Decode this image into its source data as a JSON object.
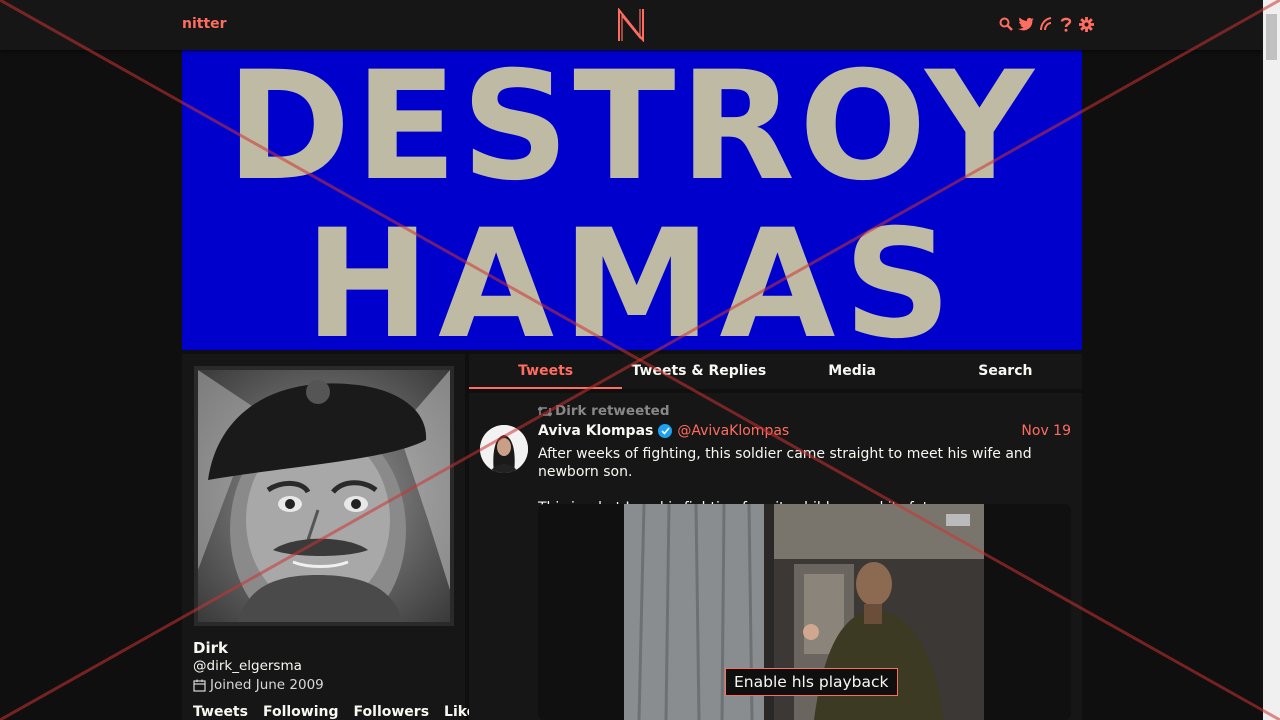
{
  "navbar": {
    "brand": "nitter",
    "icons": [
      "search-icon",
      "twitter-icon",
      "rss-icon",
      "help-icon",
      "settings-icon"
    ]
  },
  "banner": {
    "line1": "DESTROY",
    "line2": "HAMAS",
    "colors": {
      "background": "#0000cc",
      "text": "#bfbaa3"
    }
  },
  "profile": {
    "name": "Dirk",
    "handle": "@dirk_elgersma",
    "joined": "Joined June 2009",
    "stats": [
      "Tweets",
      "Following",
      "Followers",
      "Likes"
    ]
  },
  "tabs": [
    "Tweets",
    "Tweets & Replies",
    "Media",
    "Search"
  ],
  "active_tab": "Tweets",
  "tweet": {
    "retweet_label": "Dirk retweeted",
    "fullname": "Aviva Klompas",
    "username": "@AvivaKlompas",
    "date": "Nov 19",
    "text_p1": "After weeks of fighting, this soldier came straight to meet his wife and newborn son.",
    "text_p2": "This is what Israel is fighting for - its children and its future.",
    "media_button": "Enable hls playback"
  },
  "theme": {
    "accent": "#ff6c60",
    "background": "#0f0f0f",
    "panel": "#161616",
    "overlay_x": "#cc3333"
  }
}
